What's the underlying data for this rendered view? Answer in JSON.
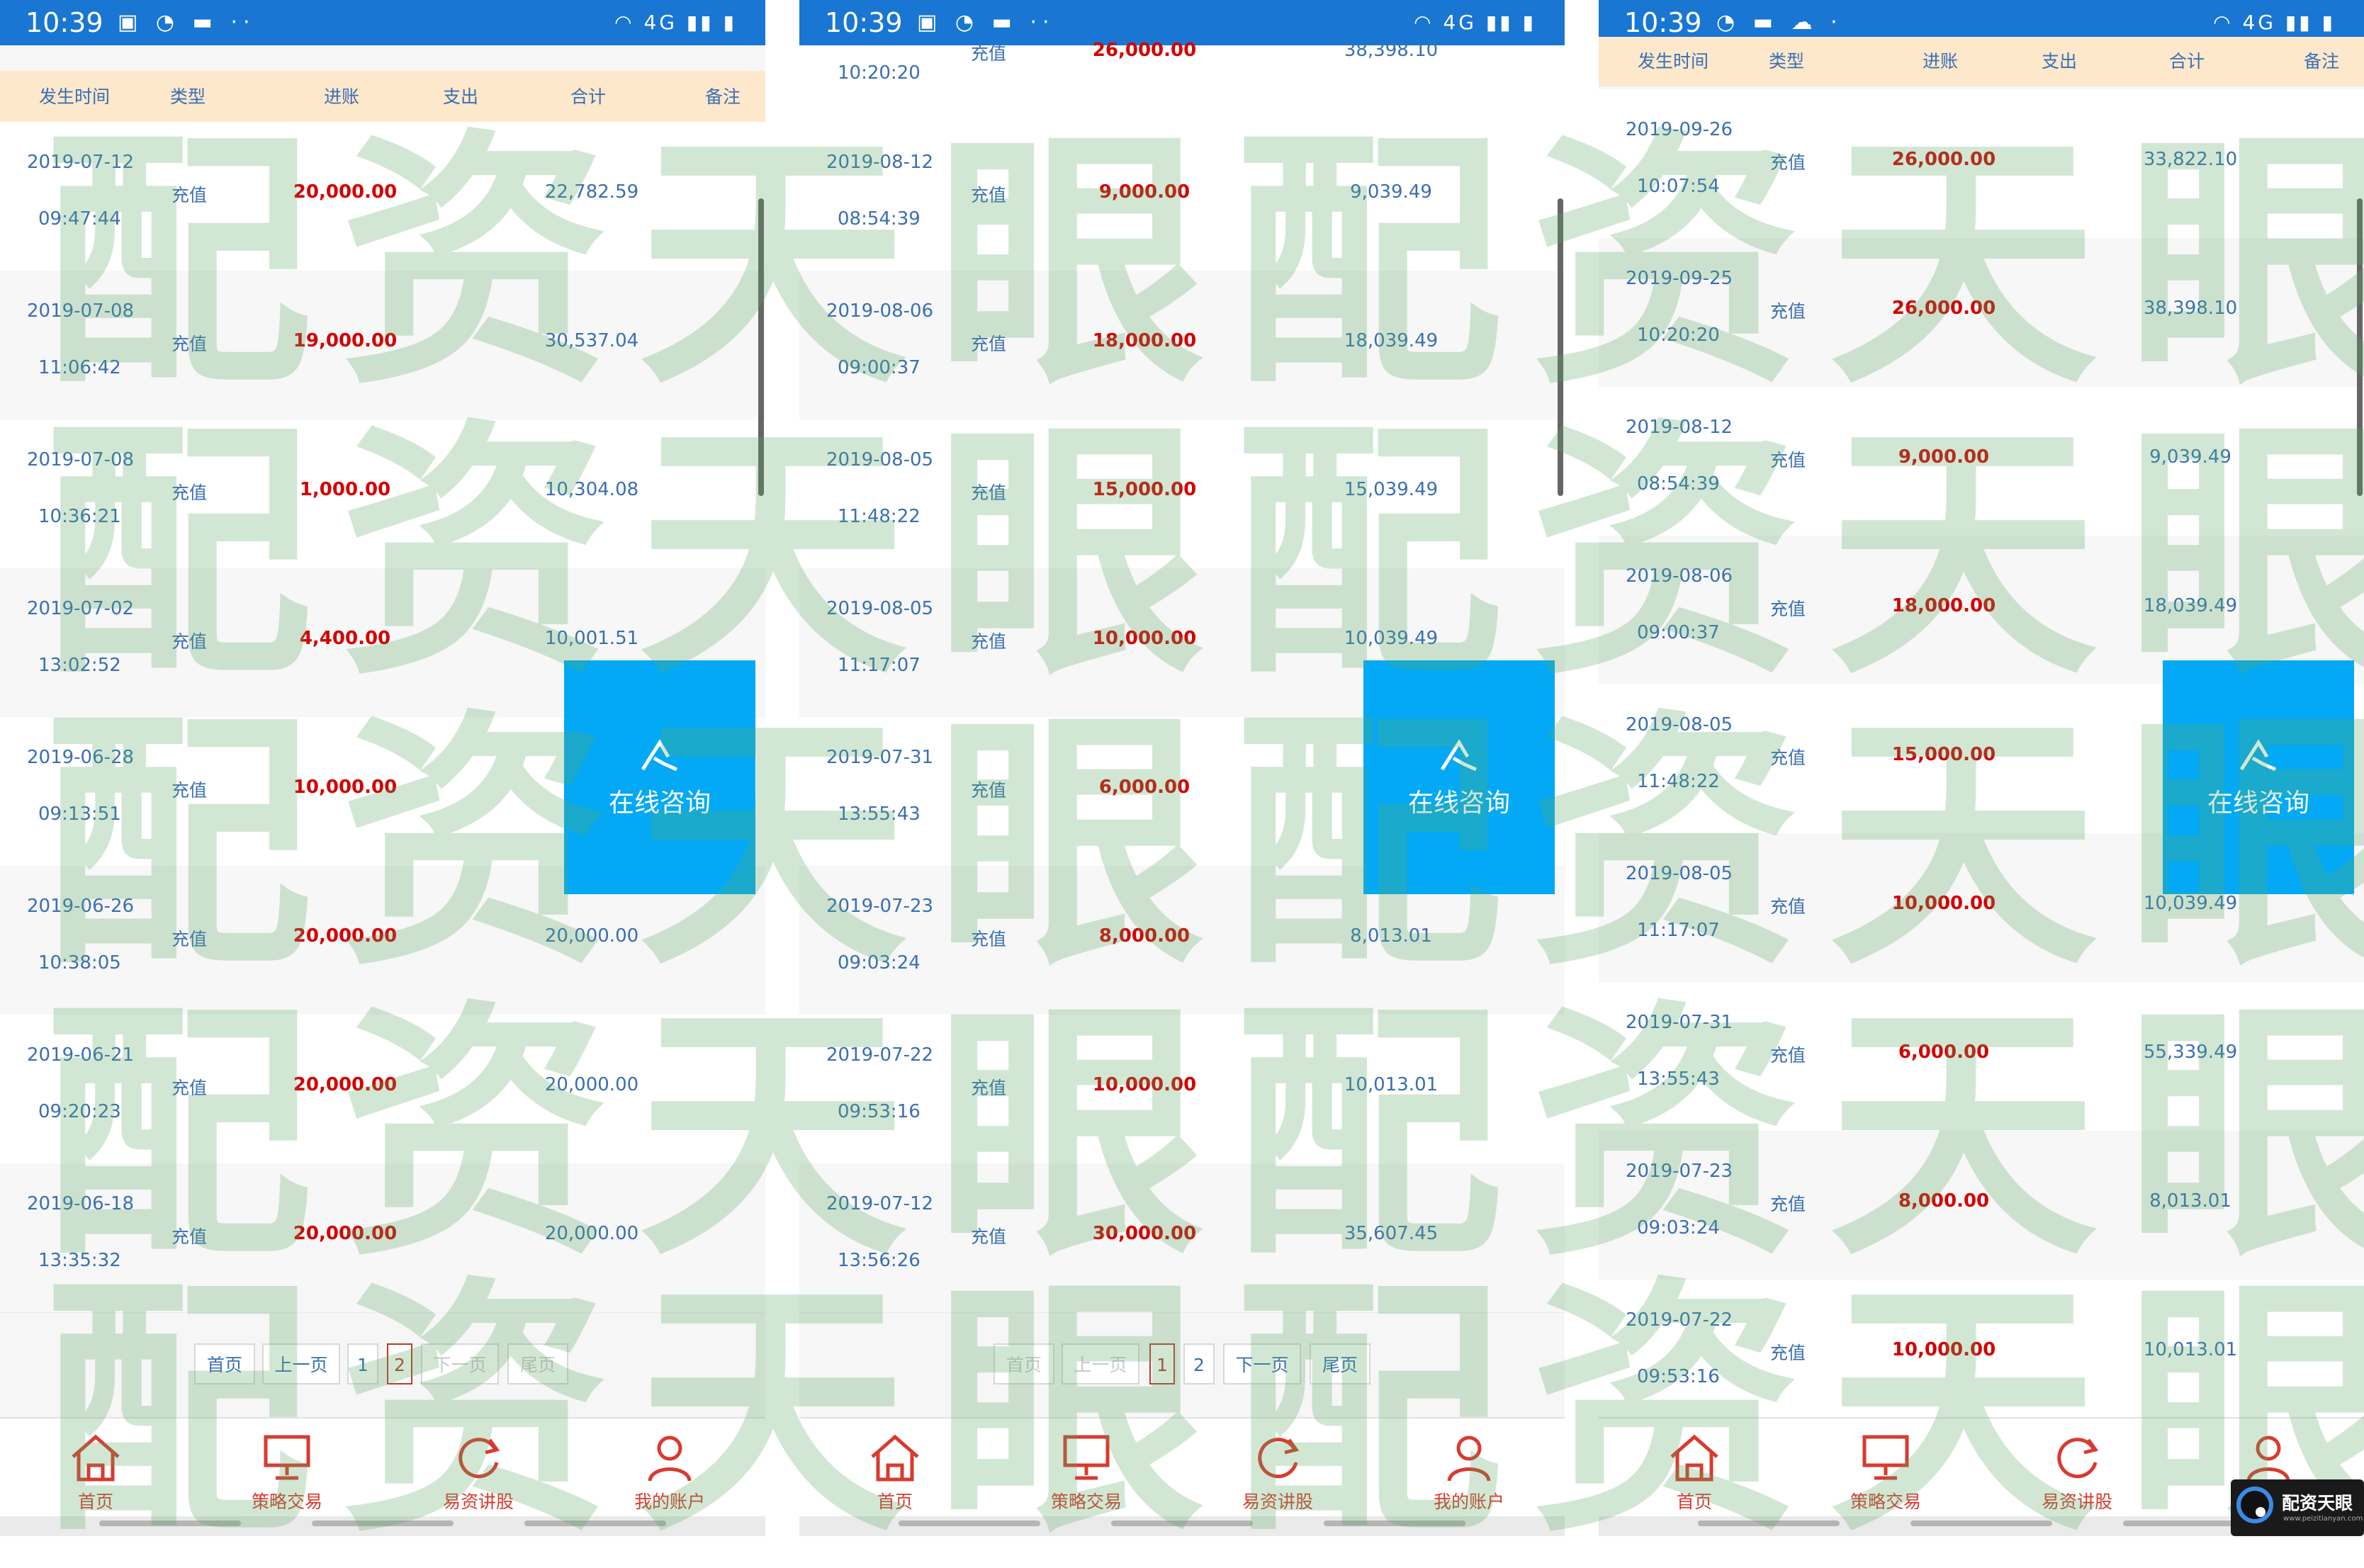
{
  "panels": [
    {
      "status": {
        "time": "10:39",
        "left_icons": "▣ ◔ ▬ ··",
        "right_icons": "◠ 4G ▮▮ ▮"
      },
      "header": {
        "time": "发生时间",
        "type": "类型",
        "in": "进账",
        "out": "支出",
        "total": "合计",
        "note": "备注"
      },
      "rows": [
        {
          "date": "2019-07-12",
          "time": "09:47:44",
          "type": "充值",
          "in": "20,000.00",
          "total": "22,782.59"
        },
        {
          "date": "2019-07-08",
          "time": "11:06:42",
          "type": "充值",
          "in": "19,000.00",
          "total": "30,537.04"
        },
        {
          "date": "2019-07-08",
          "time": "10:36:21",
          "type": "充值",
          "in": "1,000.00",
          "total": "10,304.08"
        },
        {
          "date": "2019-07-02",
          "time": "13:02:52",
          "type": "充值",
          "in": "4,400.00",
          "total": "10,001.51"
        },
        {
          "date": "2019-06-28",
          "time": "09:13:51",
          "type": "充值",
          "in": "10,000.00",
          "total": "10"
        },
        {
          "date": "2019-06-26",
          "time": "10:38:05",
          "type": "充值",
          "in": "20,000.00",
          "total": "20,000.00"
        },
        {
          "date": "2019-06-21",
          "time": "09:20:23",
          "type": "充值",
          "in": "20,000.00",
          "total": "20,000.00"
        },
        {
          "date": "2019-06-18",
          "time": "13:35:32",
          "type": "充值",
          "in": "20,000.00",
          "total": "20,000.00"
        }
      ],
      "pager": {
        "first": "首页",
        "prev": "上一页",
        "p1": "1",
        "p2": "2",
        "next": "下一页",
        "last": "尾页"
      }
    },
    {
      "status": {
        "time": "10:39",
        "left_icons": "▣ ◔ ▬ ··",
        "right_icons": "◠ 4G ▮▮ ▮"
      },
      "top_partial": {
        "type": "充值",
        "in": "26,000.00",
        "total": "38,398.10",
        "time": "10:20:20"
      },
      "rows": [
        {
          "date": "2019-08-12",
          "time": "08:54:39",
          "type": "充值",
          "in": "9,000.00",
          "total": "9,039.49"
        },
        {
          "date": "2019-08-06",
          "time": "09:00:37",
          "type": "充值",
          "in": "18,000.00",
          "total": "18,039.49"
        },
        {
          "date": "2019-08-05",
          "time": "11:48:22",
          "type": "充值",
          "in": "15,000.00",
          "total": "15,039.49"
        },
        {
          "date": "2019-08-05",
          "time": "11:17:07",
          "type": "充值",
          "in": "10,000.00",
          "total": "10,039.49"
        },
        {
          "date": "2019-07-31",
          "time": "13:55:43",
          "type": "充值",
          "in": "6,000.00",
          "total": "55"
        },
        {
          "date": "2019-07-23",
          "time": "09:03:24",
          "type": "充值",
          "in": "8,000.00",
          "total": "8,013.01"
        },
        {
          "date": "2019-07-22",
          "time": "09:53:16",
          "type": "充值",
          "in": "10,000.00",
          "total": "10,013.01"
        },
        {
          "date": "2019-07-12",
          "time": "13:56:26",
          "type": "充值",
          "in": "30,000.00",
          "total": "35,607.45"
        }
      ],
      "pager": {
        "first": "首页",
        "prev": "上一页",
        "p1": "1",
        "p2": "2",
        "next": "下一页",
        "last": "尾页"
      }
    },
    {
      "status": {
        "time": "10:39",
        "left_icons": "◔ ▬ ☁ ·",
        "right_icons": "◠ 4G ▮▮ ▮"
      },
      "header": {
        "time": "发生时间",
        "type": "类型",
        "in": "进账",
        "out": "支出",
        "total": "合计",
        "note": "备注"
      },
      "rows": [
        {
          "date": "2019-09-26",
          "time": "10:07:54",
          "type": "充值",
          "in": "26,000.00",
          "total": "33,822.10"
        },
        {
          "date": "2019-09-25",
          "time": "10:20:20",
          "type": "充值",
          "in": "26,000.00",
          "total": "38,398.10"
        },
        {
          "date": "2019-08-12",
          "time": "08:54:39",
          "type": "充值",
          "in": "9,000.00",
          "total": "9,039.49"
        },
        {
          "date": "2019-08-06",
          "time": "09:00:37",
          "type": "充值",
          "in": "18,000.00",
          "total": "18,039.49"
        },
        {
          "date": "2019-08-05",
          "time": "11:48:22",
          "type": "充值",
          "in": "15,000.00",
          "total": "15"
        },
        {
          "date": "2019-08-05",
          "time": "11:17:07",
          "type": "充值",
          "in": "10,000.00",
          "total": "10,039.49"
        },
        {
          "date": "2019-07-31",
          "time": "13:55:43",
          "type": "充值",
          "in": "6,000.00",
          "total": "55,339.49"
        },
        {
          "date": "2019-07-23",
          "time": "09:03:24",
          "type": "充值",
          "in": "8,000.00",
          "total": "8,013.01"
        },
        {
          "date": "2019-07-22",
          "time": "09:53:16",
          "type": "充值",
          "in": "10,000.00",
          "total": "10,013.01"
        }
      ]
    }
  ],
  "fab": {
    "label": "在线咨询",
    "color": "#03a9f4"
  },
  "tabbar": [
    {
      "label": "首页",
      "icon": "home-icon"
    },
    {
      "label": "策略交易",
      "icon": "monitor-icon"
    },
    {
      "label": "易资讲股",
      "icon": "refresh-icon"
    },
    {
      "label": "我的账户",
      "icon": "user-icon"
    }
  ],
  "watermark": {
    "text": "配资天眼配资天眼"
  },
  "corner_logo": {
    "text": "配资天眼",
    "url": "www.peizitianyan.com"
  },
  "colors": {
    "status_bar": "#1976d2",
    "header_bg": "#fde8cc",
    "income": "#d40000",
    "text_blue": "#3a6fb3",
    "tab_red": "#d93a2f"
  }
}
